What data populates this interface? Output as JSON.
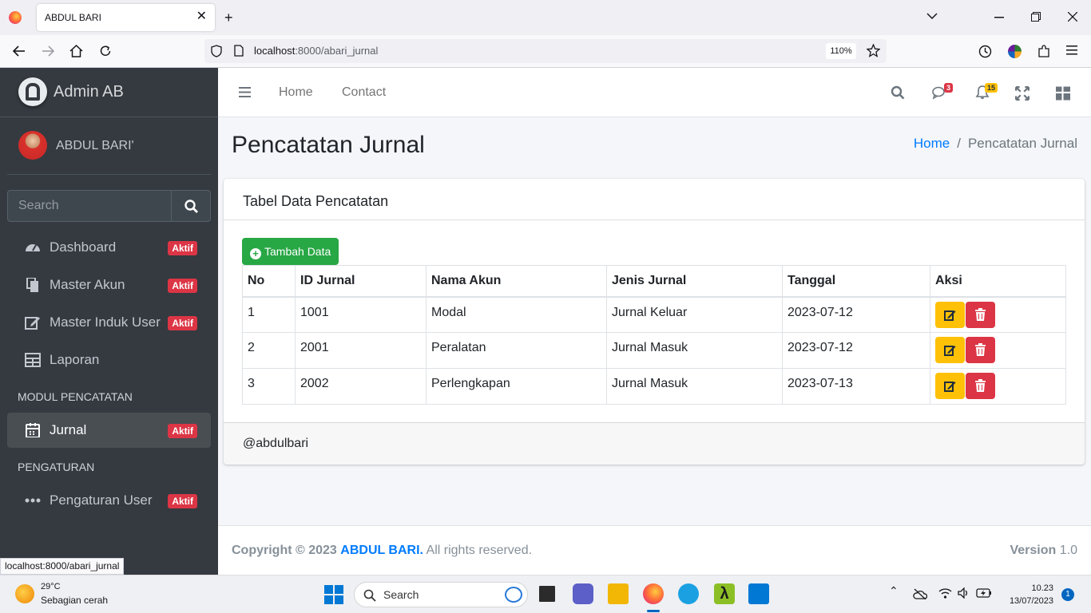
{
  "browser": {
    "tab_title": "ABDUL BARI",
    "url_host": "localhost",
    "url_rest": ":8000/abari_jurnal",
    "zoom": "110%",
    "status_url": "localhost:8000/abari_jurnal"
  },
  "sidebar": {
    "brand": "Admin AB",
    "user_name": "ABDUL BARI'",
    "search_placeholder": "Search",
    "items": [
      {
        "label": "Dashboard",
        "badge": "Aktif",
        "icon": "tachometer-icon"
      },
      {
        "label": "Master Akun",
        "badge": "Aktif",
        "icon": "copy-icon"
      },
      {
        "label": "Master Induk User",
        "badge": "Aktif",
        "icon": "edit-icon"
      },
      {
        "label": "Laporan",
        "icon": "table-icon"
      }
    ],
    "header_modul": "MODUL PENCATATAN",
    "jurnal": {
      "label": "Jurnal",
      "badge": "Aktif"
    },
    "header_pengaturan": "PENGATURAN",
    "pengaturan": {
      "label": "Pengaturan User",
      "badge": "Aktif"
    }
  },
  "topnav": {
    "home": "Home",
    "contact": "Contact",
    "messages_count": "3",
    "notifications_count": "15"
  },
  "content": {
    "title": "Pencatatan Jurnal",
    "breadcrumb_home": "Home",
    "breadcrumb_sep": "/",
    "breadcrumb_current": "Pencatatan Jurnal",
    "card_title": "Tabel Data Pencatatan",
    "add_button": "Tambah Data",
    "columns": [
      "No",
      "ID Jurnal",
      "Nama Akun",
      "Jenis Jurnal",
      "Tanggal",
      "Aksi"
    ],
    "rows": [
      [
        "1",
        "1001",
        "Modal",
        "Jurnal Keluar",
        "2023-07-12"
      ],
      [
        "2",
        "2001",
        "Peralatan",
        "Jurnal Masuk",
        "2023-07-12"
      ],
      [
        "3",
        "2002",
        "Perlengkapan",
        "Jurnal Masuk",
        "2023-07-13"
      ]
    ],
    "card_footer": "@abdulbari"
  },
  "footer": {
    "copyright_prefix": "Copyright © 2023",
    "copyright_brand": "ABDUL BARI.",
    "copyright_suffix": "All rights reserved.",
    "version_label": "Version",
    "version_value": "1.0"
  },
  "taskbar": {
    "temperature": "29°C",
    "weather": "Sebagian cerah",
    "search_placeholder": "Search",
    "time": "10.23",
    "date": "13/07/2023",
    "notification_count": "1"
  },
  "colors": {
    "sidebar_bg": "#343a40",
    "primary": "#007bff",
    "success": "#28a745",
    "warning": "#ffc107",
    "danger": "#dc3545"
  }
}
